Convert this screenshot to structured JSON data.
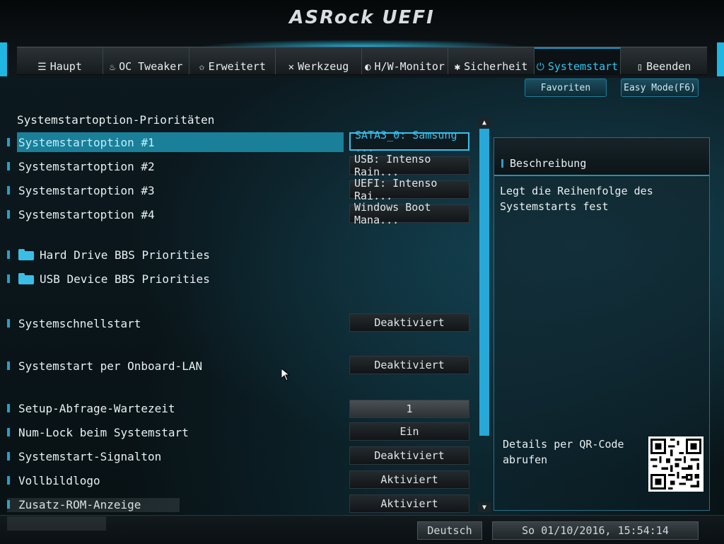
{
  "header": {
    "brand": "ASRock UEFI"
  },
  "tabs": [
    {
      "label": "Haupt",
      "icon": "list-icon",
      "glyph": "☰",
      "active": false
    },
    {
      "label": "OC Tweaker",
      "icon": "flame-icon",
      "glyph": "♨",
      "active": false
    },
    {
      "label": "Erweitert",
      "icon": "star-icon",
      "glyph": "✩",
      "active": false
    },
    {
      "label": "Werkzeug",
      "icon": "tools-icon",
      "glyph": "✕",
      "active": false
    },
    {
      "label": "H/W-Monitor",
      "icon": "monitor-icon",
      "glyph": "◐",
      "active": false
    },
    {
      "label": "Sicherheit",
      "icon": "shield-icon",
      "glyph": "✱",
      "active": false
    },
    {
      "label": "Systemstart",
      "icon": "power-icon",
      "glyph": "⏻",
      "active": true
    },
    {
      "label": "Beenden",
      "icon": "exit-icon",
      "glyph": "▯",
      "active": false
    }
  ],
  "topbuttons": {
    "favorites": "Favoriten",
    "easy_mode": "Easy Mode(F6)"
  },
  "main": {
    "section_title": "Systemstartoption-Prioritäten",
    "items": [
      {
        "label": "Systemstartoption #1",
        "value": "SATA3_0: Samsung ..."
      },
      {
        "label": "Systemstartoption #2",
        "value": "USB: Intenso Rain..."
      },
      {
        "label": "Systemstartoption #3",
        "value": "UEFI: Intenso Rai..."
      },
      {
        "label": "Systemstartoption #4",
        "value": "Windows Boot Mana..."
      },
      {
        "label": "Hard Drive BBS Priorities"
      },
      {
        "label": "USB Device BBS Priorities"
      },
      {
        "label": "Systemschnellstart",
        "value": "Deaktiviert"
      },
      {
        "label": "Systemstart per Onboard-LAN",
        "value": "Deaktiviert"
      },
      {
        "label": "Setup-Abfrage-Wartezeit",
        "value": "1"
      },
      {
        "label": "Num-Lock beim Systemstart",
        "value": "Ein"
      },
      {
        "label": "Systemstart-Signalton",
        "value": "Deaktiviert"
      },
      {
        "label": "Vollbildlogo",
        "value": "Aktiviert"
      },
      {
        "label": "Zusatz-ROM-Anzeige",
        "value": "Aktiviert"
      }
    ]
  },
  "description": {
    "title": "Beschreibung",
    "text": "Legt die Reihenfolge des Systemstarts fest",
    "qr_text": "Details per QR-Code abrufen"
  },
  "footer": {
    "language": "Deutsch",
    "datetime": "So 01/10/2016, 15:54:14"
  },
  "colors": {
    "accent": "#2fc6f2",
    "selection": "#1a7f98",
    "scrollbar": "#26a9d8"
  }
}
